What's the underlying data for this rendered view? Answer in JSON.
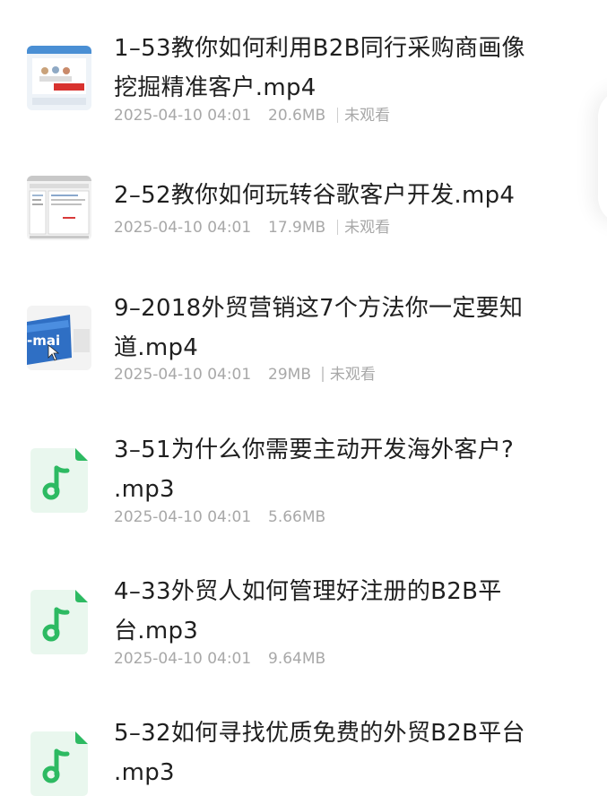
{
  "files": [
    {
      "title_line1": "1–53教你如何利用B2B同行采购商画像",
      "title_line2": "挖掘精准客户.mp4",
      "date": "2025-04-10 04:01",
      "size": "20.6MB",
      "watch_status": "未观看",
      "thumb_icon": "video-thumbnail-icon"
    },
    {
      "title_line1": "2–52教你如何玩转谷歌客户开发.mp4",
      "title_line2": "",
      "date": "2025-04-10 04:01",
      "size": "17.9MB",
      "watch_status": "未观看",
      "thumb_icon": "video-thumbnail-icon"
    },
    {
      "title_line1": "9–2018外贸营销这7个方法你一定要知",
      "title_line2": "道.mp4",
      "date": "2025-04-10 04:01",
      "size": "29MB",
      "watch_status": "未观看",
      "thumb_icon": "video-thumbnail-icon"
    },
    {
      "title_line1": "3–51为什么你需要主动开发海外客户?",
      "title_line2": ".mp3",
      "date": "2025-04-10 04:01",
      "size": "5.66MB",
      "thumb_icon": "audio-file-icon"
    },
    {
      "title_line1": "4–33外贸人如何管理好注册的B2B平",
      "title_line2": "台.mp3",
      "date": "2025-04-10 04:01",
      "size": "9.64MB",
      "thumb_icon": "audio-file-icon"
    },
    {
      "title_line1": "5–32如何寻找优质免费的外贸B2B平台",
      "title_line2": ".mp3",
      "thumb_icon": "audio-file-icon"
    }
  ],
  "colors": {
    "title": "#1f1f1f",
    "meta": "#a8a8a8",
    "audio_icon_bg": "#e9f7ee",
    "audio_icon_fg": "#2dba62"
  }
}
